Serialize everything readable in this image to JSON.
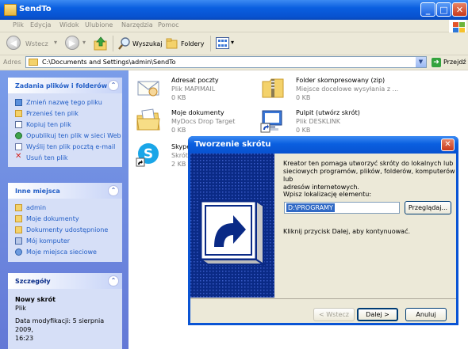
{
  "window": {
    "title": "SendTo",
    "buttons": {
      "minimize": "_",
      "maximize": "□",
      "close": "✕"
    }
  },
  "menu": {
    "items": [
      "Plik",
      "Edycja",
      "Widok",
      "Ulubione",
      "Narzędzia",
      "Pomoc"
    ]
  },
  "toolbar": {
    "back_label": "Wstecz",
    "search_label": "Wyszukaj",
    "folders_label": "Foldery"
  },
  "address": {
    "label": "Adres",
    "value": "C:\\Documents and Settings\\admin\\SendTo",
    "go_label": "Przejdź"
  },
  "tasks_panel": {
    "title": "Zadania plików i folderów",
    "items": [
      {
        "label": "Zmień nazwę tego pliku",
        "icon": "rename-icon"
      },
      {
        "label": "Przenieś ten plik",
        "icon": "move-icon"
      },
      {
        "label": "Kopiuj ten plik",
        "icon": "copy-icon"
      },
      {
        "label": "Opublikuj ten plik w sieci Web",
        "icon": "web-publish-icon"
      },
      {
        "label": "Wyślij ten plik pocztą e-mail",
        "icon": "email-icon"
      },
      {
        "label": "Usuń ten plik",
        "icon": "delete-icon"
      }
    ]
  },
  "places_panel": {
    "title": "Inne miejsca",
    "items": [
      {
        "label": "admin",
        "icon": "folder-icon"
      },
      {
        "label": "Moje dokumenty",
        "icon": "my-documents-icon"
      },
      {
        "label": "Dokumenty udostępnione",
        "icon": "shared-folder-icon"
      },
      {
        "label": "Mój komputer",
        "icon": "my-computer-icon"
      },
      {
        "label": "Moje miejsca sieciowe",
        "icon": "network-places-icon"
      }
    ]
  },
  "details_panel": {
    "title": "Szczegóły",
    "name": "Nowy skrót",
    "type": "Plik",
    "modified_line1": "Data modyfikacji: 5 sierpnia 2009,",
    "modified_line2": "16:23"
  },
  "files": [
    {
      "name": "Adresat poczty",
      "type": "Plik MAPIMAIL",
      "size": "0 KB",
      "icon": "mail-recipient-icon"
    },
    {
      "name": "Folder skompresowany (zip)",
      "type": "Miejsce docelowe wysyłania z ...",
      "size": "0 KB",
      "icon": "zip-folder-icon"
    },
    {
      "name": "Moje dokumenty",
      "type": "MyDocs Drop Target",
      "size": "0 KB",
      "icon": "my-documents-icon"
    },
    {
      "name": "Pulpit (utwórz skrót)",
      "type": "Plik DESKLINK",
      "size": "0 KB",
      "icon": "desktop-shortcut-icon"
    },
    {
      "name": "Skype",
      "type": "Skrót",
      "size": "2 KB",
      "icon": "skype-icon"
    }
  ],
  "dialog": {
    "title": "Tworzenie skrótu",
    "intro_line1": "Kreator ten pomaga utworzyć skróty do lokalnych lub",
    "intro_line2": "sieciowych programów, plików, folderów, komputerów lub",
    "intro_line3": "adresów internetowych.",
    "location_label": "Wpisz lokalizację elementu:",
    "location_value": "D:\\PROGRAMY",
    "browse_label": "Przeglądaj...",
    "continue_text": "Kliknij przycisk Dalej, aby kontynuować.",
    "back_label": "< Wstecz",
    "next_label": "Dalej >",
    "cancel_label": "Anuluj"
  }
}
